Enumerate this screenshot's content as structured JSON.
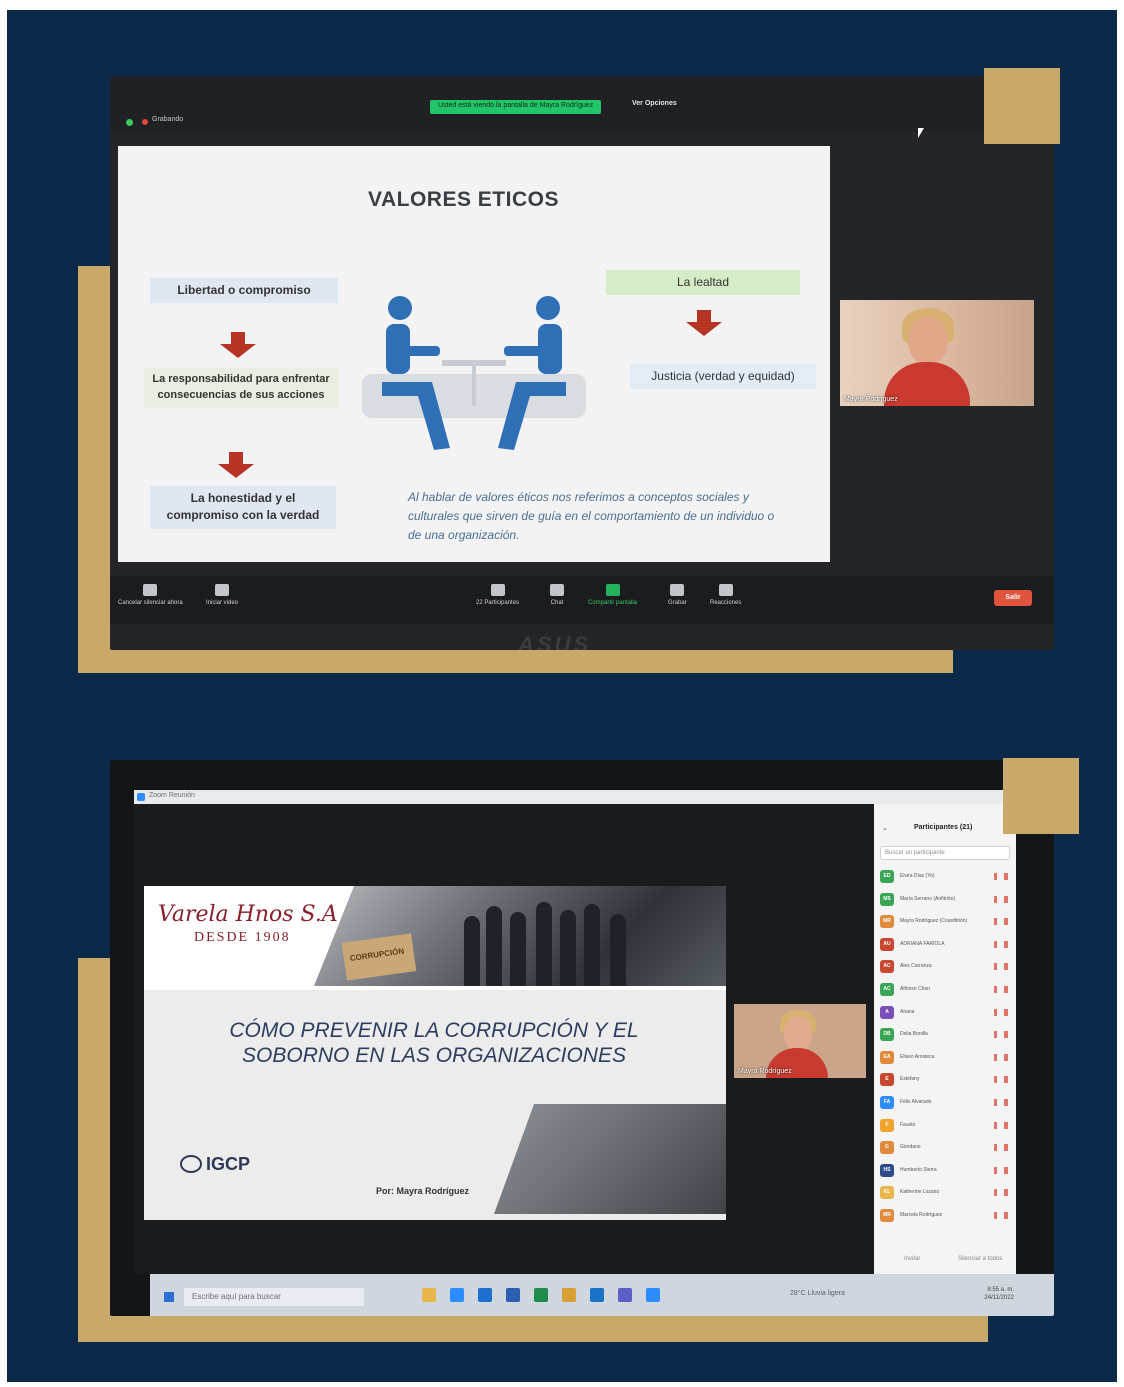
{
  "colors": {
    "panel_navy": "#0b2a4a",
    "accent_gold": "#c8a96a",
    "arrow_red": "#b73424",
    "zoom_green": "#23c56a",
    "exit_red": "#e0533c"
  },
  "screen1": {
    "status": {
      "recording_label": "Grabando",
      "viewing_banner": "Usted está viendo la pantalla de Mayra Rodríguez",
      "options_label": "Ver Opciones"
    },
    "slide": {
      "title": "VALORES ETICOS",
      "box_libertad": "Libertad o compromiso",
      "box_responsabilidad": "La responsabilidad para enfrentar consecuencias de sus acciones",
      "box_honestidad": "La honestidad y el compromiso con la verdad",
      "box_lealtad": "La lealtad",
      "box_justicia": "Justicia (verdad y equidad)",
      "quote": "Al hablar de valores éticos nos referimos a conceptos sociales y culturales que sirven de guía en el comportamiento de un individuo o de una organización."
    },
    "video_name": "Mayra Rodríguez",
    "toolbar": {
      "mute_label": "Cancelar silenciar ahora",
      "video_label": "Iniciar video",
      "participants_count": "22",
      "participants_label": "Participantes",
      "chat_label": "Chat",
      "share_label": "Compartir pantalla",
      "record_label": "Grabar",
      "reactions_label": "Reacciones",
      "exit_label": "Salir"
    },
    "monitor_brand": "ASUS"
  },
  "screen2": {
    "window_title": "Zoom Reunión",
    "slide": {
      "company_name": "Varela Hnos S.A",
      "company_since": "DESDE 1908",
      "envelope_text": "CORRUPCIÓN",
      "heading_line1": "CÓMO PREVENIR LA CORRUPCIÓN Y EL",
      "heading_line2": "SOBORNO EN LAS ORGANIZACIONES",
      "org_logo": "IGCP",
      "author": "Por: Mayra Rodríguez"
    },
    "video_name": "Mayra Rodríguez",
    "participants_panel": {
      "title": "Participantes (21)",
      "search_placeholder": "Buscar un participante",
      "participants": [
        {
          "initials": "ED",
          "name": "Elvira Díaz (Yo)",
          "color": "#3aa655"
        },
        {
          "initials": "MS",
          "name": "María Serrano (Anfitrión)",
          "color": "#3aa655"
        },
        {
          "initials": "MR",
          "name": "Mayra Rodríguez (Coanfitrión)",
          "color": "#e08a3c"
        },
        {
          "initials": "AU",
          "name": "ADRIANA FARIOLA",
          "color": "#c9462f"
        },
        {
          "initials": "AC",
          "name": "Alex Carranza",
          "color": "#c9462f"
        },
        {
          "initials": "AC",
          "name": "Alfonso Chen",
          "color": "#3aa655"
        },
        {
          "initials": "A",
          "name": "Ariana",
          "color": "#7a4fb8"
        },
        {
          "initials": "DB",
          "name": "Delia Bonilla",
          "color": "#3aa655"
        },
        {
          "initials": "EA",
          "name": "Eliseo Arosteca",
          "color": "#e08a3c"
        },
        {
          "initials": "E",
          "name": "Estefany",
          "color": "#c9462f"
        },
        {
          "initials": "FA",
          "name": "Félix Alvarado",
          "color": "#2d8cff"
        },
        {
          "initials": "F",
          "name": "Fausto",
          "color": "#f0a32b"
        },
        {
          "initials": "G",
          "name": "Giordano",
          "color": "#e08a3c"
        },
        {
          "initials": "HS",
          "name": "Humberto Sierra",
          "color": "#2d4a8a"
        },
        {
          "initials": "KL",
          "name": "Katherine Lozano",
          "color": "#e8b64a"
        },
        {
          "initials": "MR",
          "name": "Marcela Rodríguez",
          "color": "#e08a3c"
        }
      ],
      "footer_invite": "Invitar",
      "footer_mute_all": "Silenciar a todos"
    },
    "taskbar": {
      "search_placeholder": "Escribe aquí para buscar",
      "weather": "28°C Lluvia ligera",
      "time": "8:55 a. m.",
      "date": "24/11/2022"
    }
  }
}
